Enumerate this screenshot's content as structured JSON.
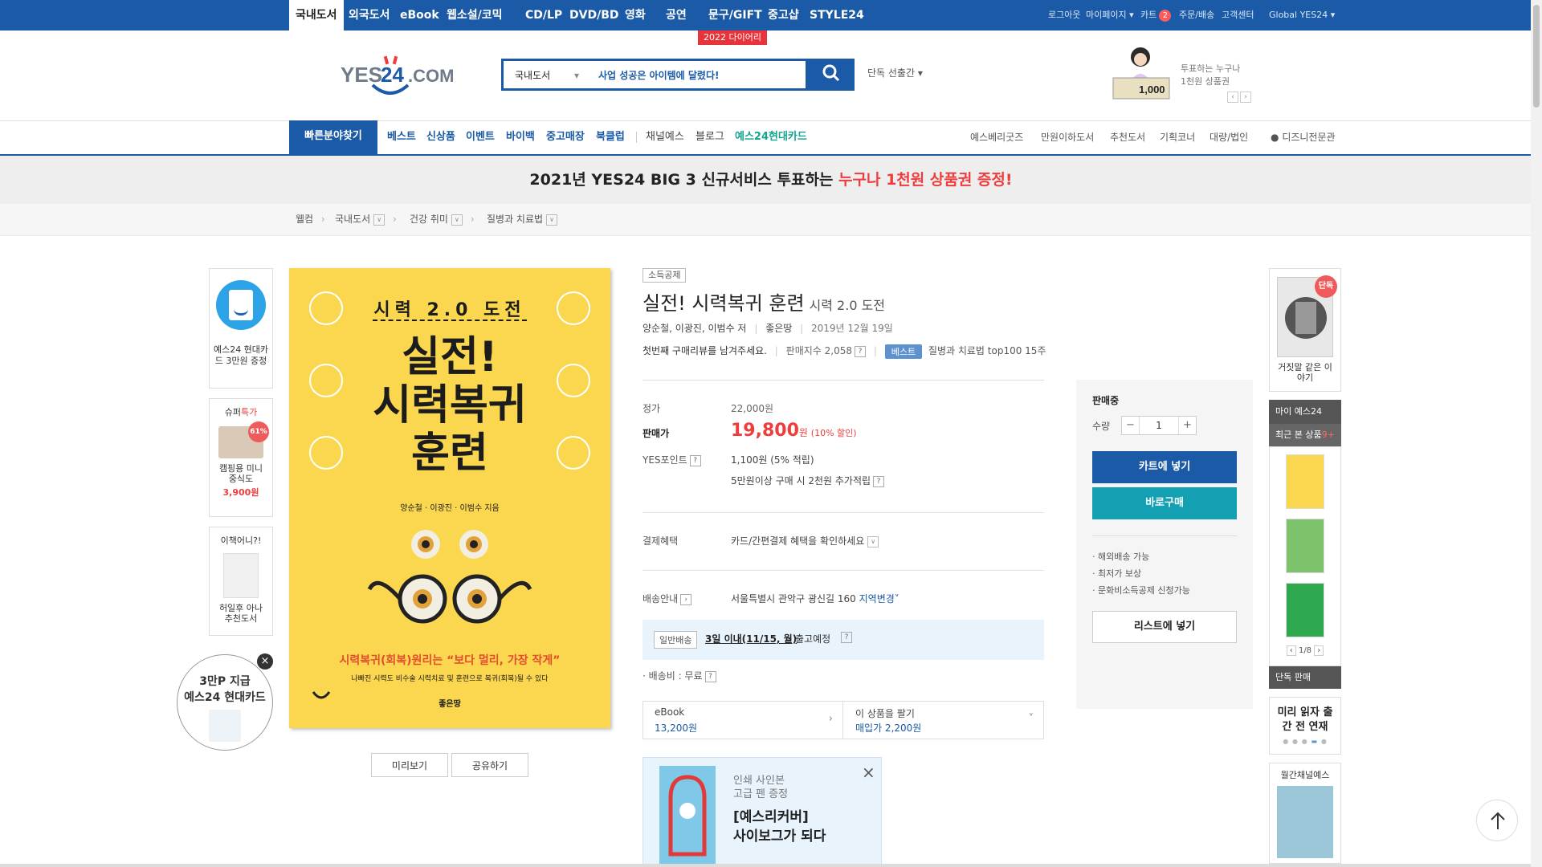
{
  "top_nav": {
    "items": [
      "국내도서",
      "외국도서",
      "eBook",
      "웹소설/코믹",
      "CD/LP",
      "DVD/BD",
      "영화",
      "공연",
      "문구/GIFT",
      "중고샵",
      "STYLE24"
    ],
    "util": {
      "logout": "로그아웃",
      "mypage": "마이페이지",
      "cart": "카트",
      "cart_count": "2",
      "orders": "주문/배송",
      "support": "고객센터",
      "global": "Global YES24"
    }
  },
  "diary_tag": "2022 다이어리",
  "logo_text": "YES24.COM",
  "search": {
    "category": "국내도서",
    "query": "사업 성공은 아이템에 달렸다!",
    "exclusive": "단독 선출간"
  },
  "header_promo": {
    "amount": "1,000",
    "line1": "투표하는 누구나",
    "line2": "1천원 상품권"
  },
  "sub_nav": {
    "quick": "빠른분야찾기",
    "left": [
      "베스트",
      "신상품",
      "이벤트",
      "바이백",
      "중고매장",
      "북클럽"
    ],
    "mid": [
      "채널예스",
      "블로그"
    ],
    "card": "예스24현대카드",
    "right": [
      "예스베리굿즈",
      "만원이하도서",
      "추천도서",
      "기획코너",
      "대량/법인",
      "디즈니전문관"
    ]
  },
  "banner": {
    "text": "2021년 YES24 BIG 3 신규서비스 투표하는 ",
    "highlight": "누구나 1천원 상품권 증정!"
  },
  "breadcrumb": [
    "웰컴",
    "국내도서",
    "건강 취미",
    "질병과 치료법"
  ],
  "left_float": {
    "card_ad": "예스24 현대카드 3만원 증정",
    "super_label": "슈퍼",
    "super_hl": "특가",
    "super_pct": "61%",
    "super_item": "캠핑용 미니 중식도",
    "super_price": "3,900원",
    "whatbook": "이책어니?!",
    "whatbook_sub": "허일후 아나 추천도서",
    "circle_line1": "3만P 지급",
    "circle_line2": "예스24 현대카드"
  },
  "cover": {
    "top": "시력 2.0 도전",
    "title1": "실전!",
    "title2": "시력복귀",
    "title3": "훈련",
    "authors": "양순철 · 이광진 · 이범수 지음",
    "tagline": "시력복귀(회복)원리는 “보다 멀리, 가장 작게”",
    "tagline2": "나빠진 시력도 비수술 시력치료 및 훈련으로 복귀(회복)될 수 있다",
    "publisher": "좋은땅"
  },
  "cover_buttons": {
    "preview": "미리보기",
    "share": "공유하기"
  },
  "product": {
    "tag": "소득공제",
    "title": "실전! 시력복귀 훈련",
    "subtitle": "시력 2.0 도전",
    "authors": "양순철, 이광진, 이범수 저",
    "publisher": "좋은땅",
    "date": "2019년 12월 19일",
    "review_prompt": "첫번째 구매리뷰를 남겨주세요.",
    "sales_index": "판매지수 2,058",
    "best_badge": "베스트",
    "rank": "질병과 치료법 top100 15주"
  },
  "price": {
    "list_label": "정가",
    "list": "22,000원",
    "sale_label": "판매가",
    "sale": "19,800",
    "won": "원",
    "discount": "(10% 할인)",
    "point_label": "YES포인트",
    "point": "1,100원 (5% 적립)",
    "point_extra": "5만원이상 구매 시 2천원 추가적립",
    "pay_label": "결제혜택",
    "pay": "카드/간편결제 혜택을 확인하세요",
    "ship_label": "배송안내",
    "address": "서울특별시 관악구 광신길 160",
    "region": "지역변경",
    "ship_type": "일반배송",
    "ship_date": "3일 이내(11/15, 월)",
    "ship_suffix": "출고예정",
    "fee": "· 배송비 : 무료"
  },
  "ebook": {
    "label": "eBook",
    "price": "13,200원",
    "sell_label": "이 상품을 팔기",
    "sell_price": "매입가 2,200원"
  },
  "print_promo": {
    "line1": "인쇄 사인본",
    "line2": "고급 펜 증정",
    "line3": "[예스리커버]",
    "line4": "사이보그가 되다"
  },
  "buy": {
    "status": "판매중",
    "qty_label": "수량",
    "qty": "1",
    "cart": "카트에 넣기",
    "buy_now": "바로구매",
    "notes": [
      "해외배송 가능",
      "최저가 보상",
      "문화비소득공제 신청가능"
    ],
    "wishlist": "리스트에 넣기"
  },
  "right_side": {
    "exclusive_badge": "단독",
    "exclusive_book": "거짓말 같은 이야기",
    "my_label": "마이 예스24",
    "recent": "최근 본 상품",
    "recent_count": "9+",
    "page": "1/8",
    "exclusive_sale": "단독 판매",
    "preview_serial": "미리 읽자 출간 전 연재",
    "channel": "월간채널예스"
  },
  "colors": {
    "brand": "#1b5aa6",
    "sale": "#ef3c3c",
    "teal": "#13a0b3",
    "banner_hl": "#ef3c3c"
  }
}
